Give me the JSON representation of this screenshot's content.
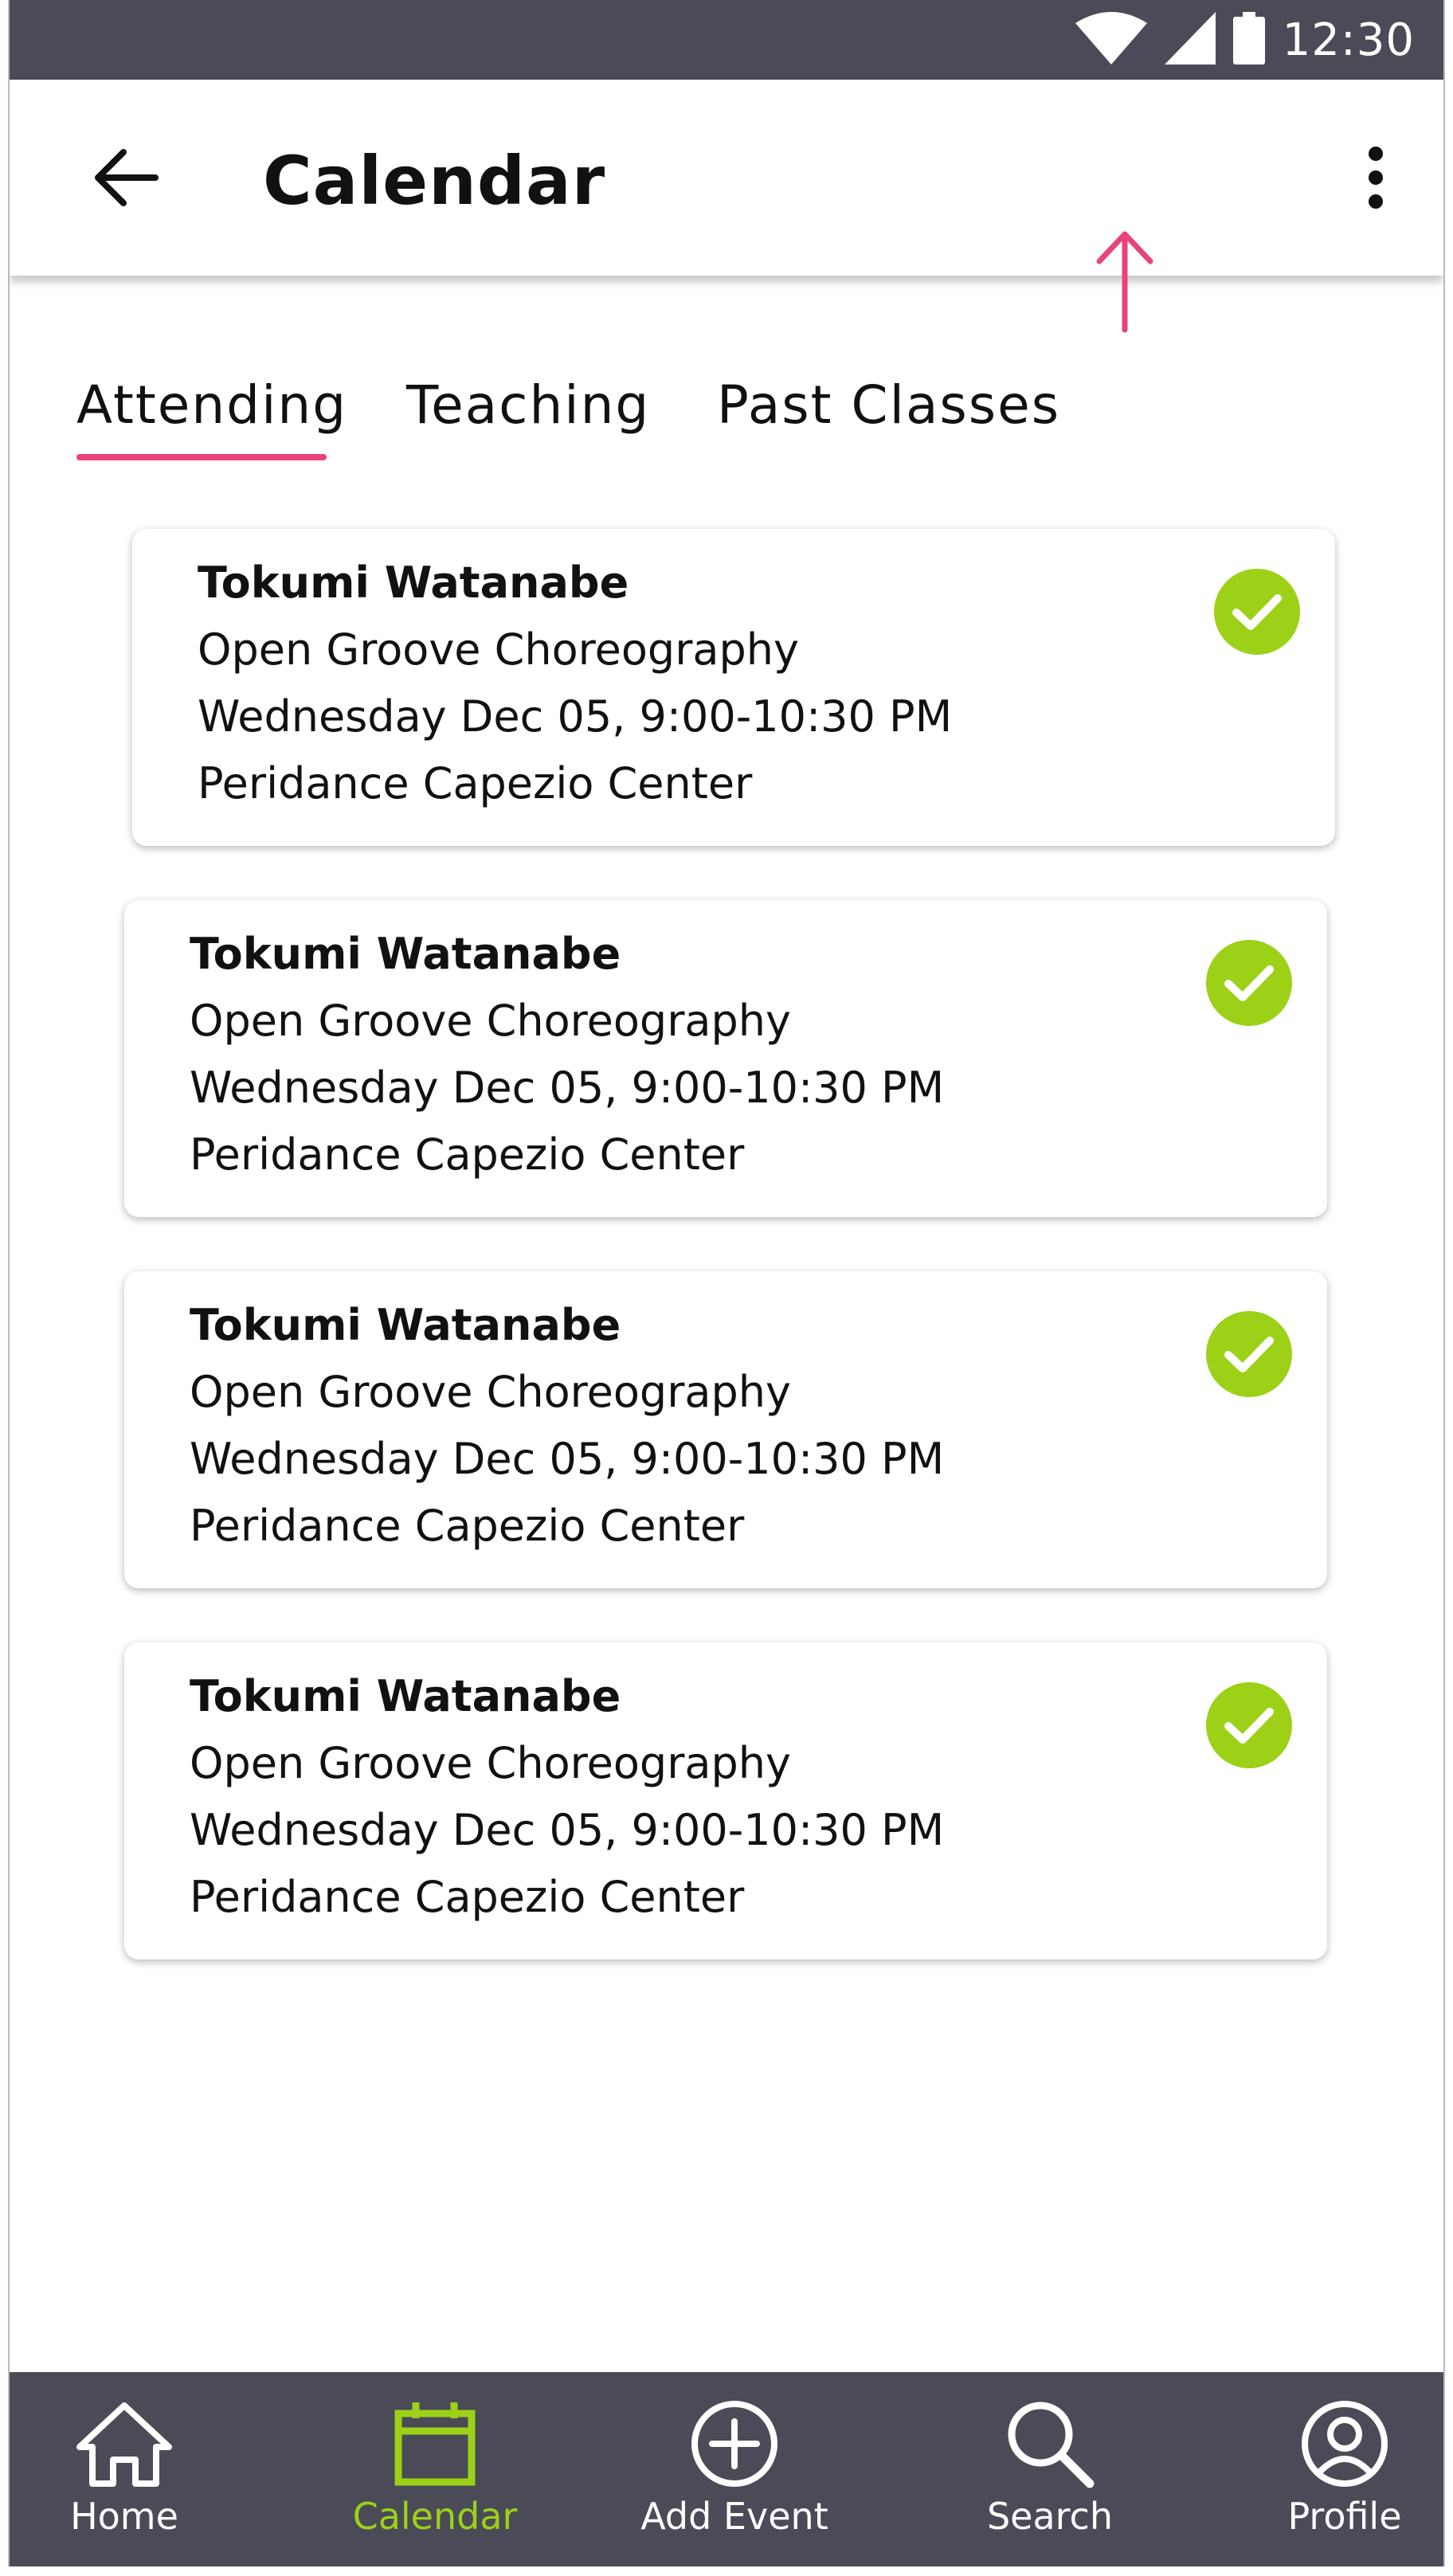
{
  "status_bar": {
    "time": "12:30",
    "icons": [
      "wifi-icon",
      "signal-icon",
      "battery-icon"
    ]
  },
  "header": {
    "title": "Calendar",
    "back_icon": "arrow-left-icon",
    "menu_icon": "more-vert-icon"
  },
  "tabs": [
    {
      "label": "Attending",
      "active": true
    },
    {
      "label": "Teaching",
      "active": false
    },
    {
      "label": "Past Classes",
      "active": false
    }
  ],
  "events": [
    {
      "instructor": "Tokumi Watanabe",
      "class_name": "Open Groove Choreography",
      "datetime": "Wednesday Dec 05, 9:00-10:30 PM",
      "venue": "Peridance Capezio Center",
      "status_icon": "check-circle-icon"
    },
    {
      "instructor": "Tokumi Watanabe",
      "class_name": "Open Groove Choreography",
      "datetime": "Wednesday Dec 05, 9:00-10:30 PM",
      "venue": "Peridance Capezio Center",
      "status_icon": "check-circle-icon"
    },
    {
      "instructor": "Tokumi Watanabe",
      "class_name": "Open Groove Choreography",
      "datetime": "Wednesday Dec 05, 9:00-10:30 PM",
      "venue": "Peridance Capezio Center",
      "status_icon": "check-circle-icon"
    },
    {
      "instructor": "Tokumi Watanabe",
      "class_name": "Open Groove Choreography",
      "datetime": "Wednesday Dec 05, 9:00-10:30 PM",
      "venue": "Peridance Capezio Center",
      "status_icon": "check-circle-icon"
    }
  ],
  "bottom_nav": [
    {
      "label": "Home",
      "icon": "home-icon",
      "active": false
    },
    {
      "label": "Calendar",
      "icon": "calendar-icon",
      "active": true
    },
    {
      "label": "Add Event",
      "icon": "add-circle-icon",
      "active": false
    },
    {
      "label": "Search",
      "icon": "search-icon",
      "active": false
    },
    {
      "label": "Profile",
      "icon": "profile-icon",
      "active": false
    }
  ],
  "colors": {
    "bars": "#4a4b57",
    "accent_pink": "#e8447a",
    "accent_green": "#9cd117",
    "text": "#111111"
  }
}
